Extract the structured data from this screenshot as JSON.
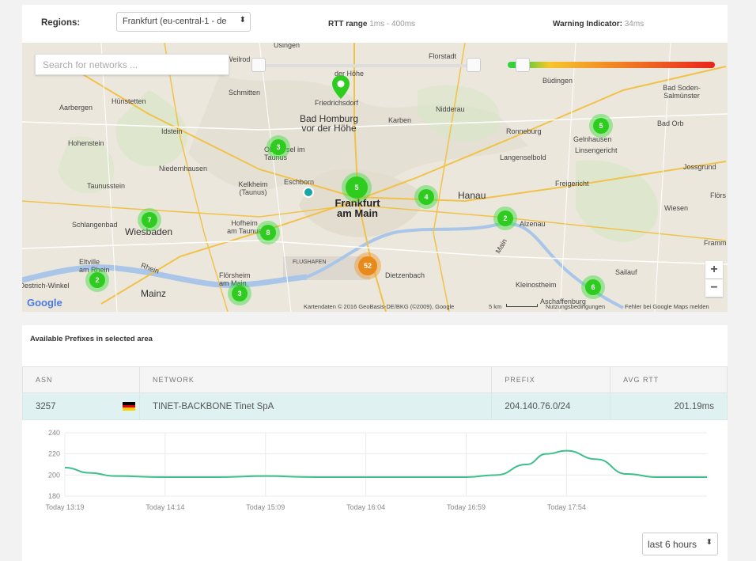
{
  "topbar": {
    "regions_label": "Regions:",
    "region_value": "Frankfurt (eu-central-1 - de",
    "rtt_label": "RTT range",
    "rtt_value": "1ms - 400ms",
    "warning_label": "Warning Indicator:",
    "warning_value": "34ms"
  },
  "map": {
    "search_placeholder": "Search for networks ...",
    "rtt_range_ms": [
      1,
      400
    ],
    "warning_threshold_ms": 34,
    "places": [
      {
        "name": "Usingen",
        "size": "small"
      },
      {
        "name": "Florstadt",
        "size": "small"
      },
      {
        "name": "Weilrod",
        "size": "small"
      },
      {
        "name": "der Höhe",
        "size": "small"
      },
      {
        "name": "Büdingen",
        "size": "small"
      },
      {
        "name": "Bad Soden-Salmünster",
        "size": "small"
      },
      {
        "name": "Aarbergen",
        "size": "small"
      },
      {
        "name": "Hünstetten",
        "size": "small"
      },
      {
        "name": "Schmitten",
        "size": "small"
      },
      {
        "name": "Friedrichsdorf",
        "size": "small"
      },
      {
        "name": "Nidderau",
        "size": "small"
      },
      {
        "name": "Bad Homburg vor der Höhe",
        "size": "big"
      },
      {
        "name": "Karben",
        "size": "small"
      },
      {
        "name": "Idstein",
        "size": "small"
      },
      {
        "name": "Ronneburg",
        "size": "small"
      },
      {
        "name": "Gelnhausen",
        "size": "small"
      },
      {
        "name": "Linsengericht",
        "size": "small"
      },
      {
        "name": "Bad Orb",
        "size": "small"
      },
      {
        "name": "Hohenstein",
        "size": "small"
      },
      {
        "name": "Oberursel im Taunus",
        "size": "small"
      },
      {
        "name": "Langenselbold",
        "size": "small"
      },
      {
        "name": "Niedernhausen",
        "size": "small"
      },
      {
        "name": "Jossgrund",
        "size": "small"
      },
      {
        "name": "Taunusstein",
        "size": "small"
      },
      {
        "name": "Kelkheim (Taunus)",
        "size": "small"
      },
      {
        "name": "Eschborn",
        "size": "small"
      },
      {
        "name": "Frankfurt am Main",
        "size": "city"
      },
      {
        "name": "Hanau",
        "size": "big"
      },
      {
        "name": "Freigericht",
        "size": "small"
      },
      {
        "name": "Flörs",
        "size": "small"
      },
      {
        "name": "Wiesen",
        "size": "small"
      },
      {
        "name": "Schlangenbad",
        "size": "small"
      },
      {
        "name": "Wiesbaden",
        "size": "big"
      },
      {
        "name": "Hofheim am Taunus",
        "size": "small"
      },
      {
        "name": "Alzenau",
        "size": "small"
      },
      {
        "name": "Framm",
        "size": "small"
      },
      {
        "name": "Eltville am Rhein",
        "size": "small"
      },
      {
        "name": "Oestrich-Winkel",
        "size": "small"
      },
      {
        "name": "Flörsheim am Main",
        "size": "small"
      },
      {
        "name": "Dietzenbach",
        "size": "small"
      },
      {
        "name": "Sailauf",
        "size": "small"
      },
      {
        "name": "Mainz",
        "size": "big"
      },
      {
        "name": "Kleinostheim",
        "size": "small"
      },
      {
        "name": "Aschaffenburg",
        "size": "small"
      },
      {
        "name": "Main",
        "size": "small"
      },
      {
        "name": "Rhein",
        "size": "small"
      },
      {
        "name": "FLUGHAFEN",
        "size": "small"
      }
    ],
    "clusters": [
      {
        "count": "3",
        "color": "green"
      },
      {
        "count": "5",
        "color": "green"
      },
      {
        "count": "5",
        "color": "green"
      },
      {
        "count": "4",
        "color": "green"
      },
      {
        "count": "2",
        "color": "green"
      },
      {
        "count": "7",
        "color": "green"
      },
      {
        "count": "8",
        "color": "green"
      },
      {
        "count": "2",
        "color": "green"
      },
      {
        "count": "3",
        "color": "green"
      },
      {
        "count": "52",
        "color": "orange"
      },
      {
        "count": "6",
        "color": "green"
      }
    ],
    "zoom_in": "+",
    "zoom_out": "−",
    "google_logo": "Google",
    "attribution": "Kartendaten © 2016 GeoBasis-DE/BKG (©2009), Google",
    "scale_text": "5 km",
    "terms": "Nutzungsbedingungen",
    "report": "Fehler bei Google Maps melden"
  },
  "prefixes": {
    "title": "Available Prefixes in selected area",
    "columns": [
      "ASN",
      "NETWORK",
      "PREFIX",
      "AVG RTT"
    ],
    "rows": [
      {
        "asn": "3257",
        "country": "DE",
        "network": "TINET-BACKBONE Tinet SpA",
        "prefix": "204.140.76.0/24",
        "avg_rtt": "201.19ms"
      }
    ]
  },
  "chart_data": {
    "type": "line",
    "title": "",
    "xlabel": "",
    "ylabel": "",
    "ylim": [
      180,
      240
    ],
    "yticks": [
      180,
      200,
      220,
      240
    ],
    "xtick_labels": [
      "Today 13:19",
      "Today 14:14",
      "Today 15:09",
      "Today 16:04",
      "Today 16:59",
      "Today 17:54"
    ],
    "grid": true,
    "series": [
      {
        "color": "#3cbf8a",
        "x": [
          0,
          0.25,
          0.5,
          1.0,
          1.5,
          2.0,
          2.5,
          3.0,
          3.5,
          4.0,
          4.3,
          4.6,
          4.8,
          5.0,
          5.3,
          5.6,
          5.9,
          6.2,
          6.4
        ],
        "y": [
          207,
          202,
          199,
          198,
          198,
          199,
          198,
          198,
          198,
          198,
          200,
          210,
          220,
          223,
          215,
          201,
          198,
          198,
          198
        ]
      }
    ]
  },
  "range_select": {
    "value": "last 6 hours"
  }
}
